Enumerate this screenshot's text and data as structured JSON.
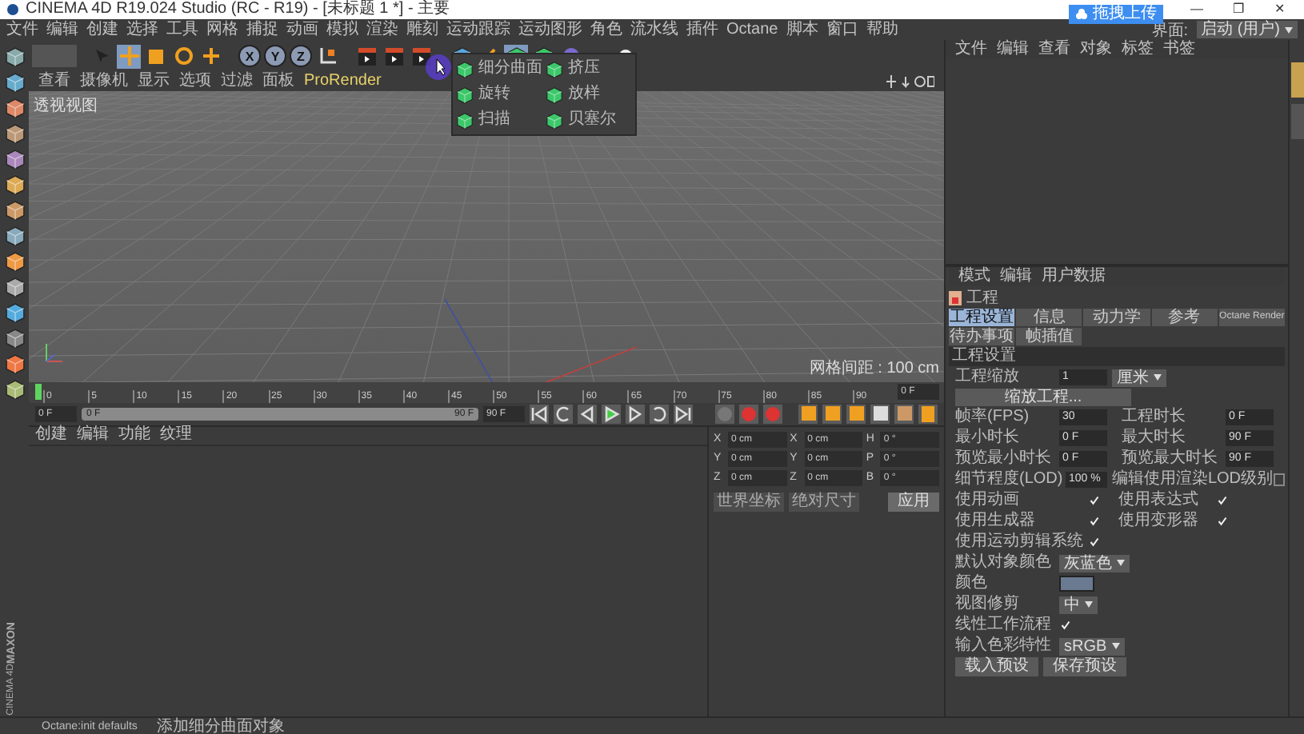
{
  "window": {
    "title": "CINEMA 4D R19.024 Studio (RC - R19) - [未标题 1 *] - 主要",
    "controls": [
      "—",
      "❐",
      "✕"
    ]
  },
  "upload_badge": {
    "label": "拖拽上传"
  },
  "menu_bar": {
    "items": [
      "文件",
      "编辑",
      "创建",
      "选择",
      "工具",
      "网格",
      "捕捉",
      "动画",
      "模拟",
      "渲染",
      "雕刻",
      "运动跟踪",
      "运动图形",
      "角色",
      "流水线",
      "插件",
      "Octane",
      "脚本",
      "窗口",
      "帮助"
    ],
    "layout_label": "界面:",
    "layout_value": "启动 (用户)"
  },
  "toolbar": {
    "axis_buttons": [
      "X",
      "Y",
      "Z"
    ]
  },
  "popup_menu": {
    "items": [
      {
        "label": "细分曲面"
      },
      {
        "label": "挤压"
      },
      {
        "label": "旋转"
      },
      {
        "label": "放样"
      },
      {
        "label": "扫描"
      },
      {
        "label": "贝塞尔"
      }
    ]
  },
  "viewport": {
    "menus": [
      "查看",
      "摄像机",
      "显示",
      "选项",
      "过滤",
      "面板",
      "ProRender"
    ],
    "label": "透视视图",
    "grid_spacing": "网格间距 : 100 cm"
  },
  "object_manager": {
    "menus": [
      "文件",
      "编辑",
      "查看",
      "对象",
      "标签",
      "书签"
    ]
  },
  "attributes": {
    "menus": [
      "模式",
      "编辑",
      "用户数据"
    ],
    "object": "工程",
    "tabs": [
      {
        "label": "工程设置",
        "selected": true
      },
      {
        "label": "信息",
        "selected": false
      },
      {
        "label": "动力学",
        "selected": false
      },
      {
        "label": "参考",
        "selected": false
      },
      {
        "label": "Octane Render",
        "selected": false
      },
      {
        "label": "待办事项",
        "selected": false
      },
      {
        "label": "帧插值",
        "selected": false
      }
    ],
    "section": "工程设置",
    "scale": {
      "label": "工程缩放",
      "value": "1",
      "unit": "厘米"
    },
    "scale_button": "缩放工程...",
    "time_rows": [
      {
        "label": "帧率(FPS)",
        "value": "30",
        "label2": "工程时长",
        "value2": "0 F"
      },
      {
        "label": "最小时长",
        "value": "0 F",
        "label2": "最大时长",
        "value2": "90 F"
      },
      {
        "label": "预览最小时长",
        "value": "0 F",
        "label2": "预览最大时长",
        "value2": "90 F"
      }
    ],
    "lod": {
      "label": "细节程度(LOD)",
      "value": "100 %",
      "render_lod_label": "编辑使用渲染LOD级别",
      "render_lod_checked": false
    },
    "options": [
      {
        "label": "使用动画",
        "checked": true
      },
      {
        "label": "使用表达式",
        "checked": true
      },
      {
        "label": "使用生成器",
        "checked": true
      },
      {
        "label": "使用变形器",
        "checked": true
      },
      {
        "label": "使用运动剪辑系统",
        "checked": true
      }
    ],
    "default_color": {
      "label": "默认对象颜色",
      "value": "灰蓝色"
    },
    "color_label": "颜色",
    "view_clipping": {
      "label": "视图修剪",
      "value": "中"
    },
    "linear_workflow": {
      "label": "线性工作流程",
      "checked": true
    },
    "input_color_profile": {
      "label": "输入色彩特性",
      "value": "sRGB"
    },
    "buttons": [
      "载入预设",
      "保存预设"
    ]
  },
  "timeline": {
    "ticks": [
      "0",
      "5",
      "10",
      "15",
      "20",
      "25",
      "30",
      "35",
      "40",
      "45",
      "50",
      "55",
      "60",
      "65",
      "70",
      "75",
      "80",
      "85",
      "90"
    ],
    "current_frame": "0 F",
    "start": "0 F",
    "preview_range": {
      "level": 1
    },
    "range_start": "0 F",
    "range_end": "90 F",
    "end": "90 F"
  },
  "material_manager": {
    "menus": [
      "创建",
      "编辑",
      "功能",
      "纹理"
    ]
  },
  "coordinates": {
    "rows": [
      {
        "axis": "X",
        "position": "0 cm",
        "size_axis": "X",
        "size": "0 cm",
        "rot_axis": "H",
        "rotation": "0 °"
      },
      {
        "axis": "Y",
        "position": "0 cm",
        "size_axis": "Y",
        "size": "0 cm",
        "rot_axis": "P",
        "rotation": "0 °"
      },
      {
        "axis": "Z",
        "position": "0 cm",
        "size_axis": "Z",
        "size": "0 cm",
        "rot_axis": "B",
        "rotation": "0 °"
      }
    ],
    "dropdowns": [
      "世界坐标",
      "绝对尺寸"
    ],
    "apply": "应用"
  },
  "status_bar": {
    "texts": [
      "Octane:init defaults",
      "添加细分曲面对象"
    ]
  },
  "logo": {
    "brand": "MAXON",
    "product": "CINEMA 4D"
  }
}
